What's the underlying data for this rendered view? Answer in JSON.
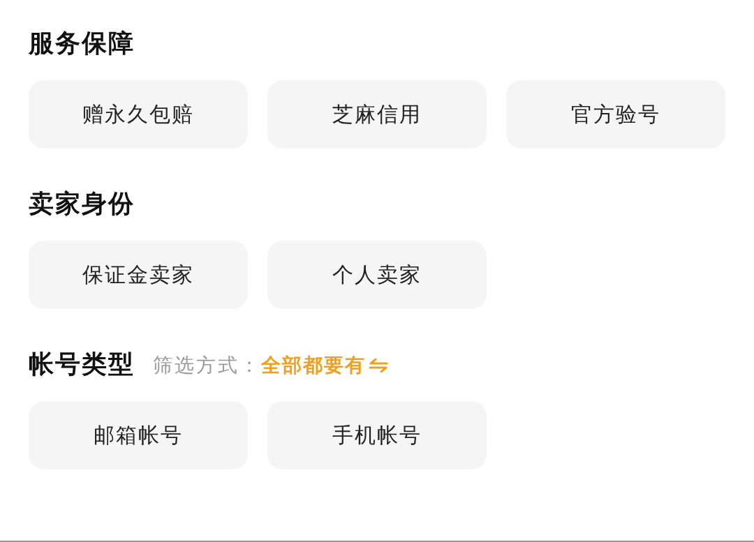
{
  "sections": [
    {
      "title": "服务保障",
      "options": [
        {
          "label": "赠永久包赔",
          "selected": false
        },
        {
          "label": "芝麻信用",
          "selected": false
        },
        {
          "label": "官方验号",
          "selected": false
        }
      ]
    },
    {
      "title": "卖家身份",
      "options": [
        {
          "label": "保证金卖家",
          "selected": false
        },
        {
          "label": "个人卖家",
          "selected": false
        }
      ]
    },
    {
      "title": "帐号类型",
      "filter": {
        "label": "筛选方式：",
        "value": "全部都要有"
      },
      "options": [
        {
          "label": "邮箱帐号",
          "selected": false
        },
        {
          "label": "手机帐号",
          "selected": false
        }
      ]
    }
  ]
}
